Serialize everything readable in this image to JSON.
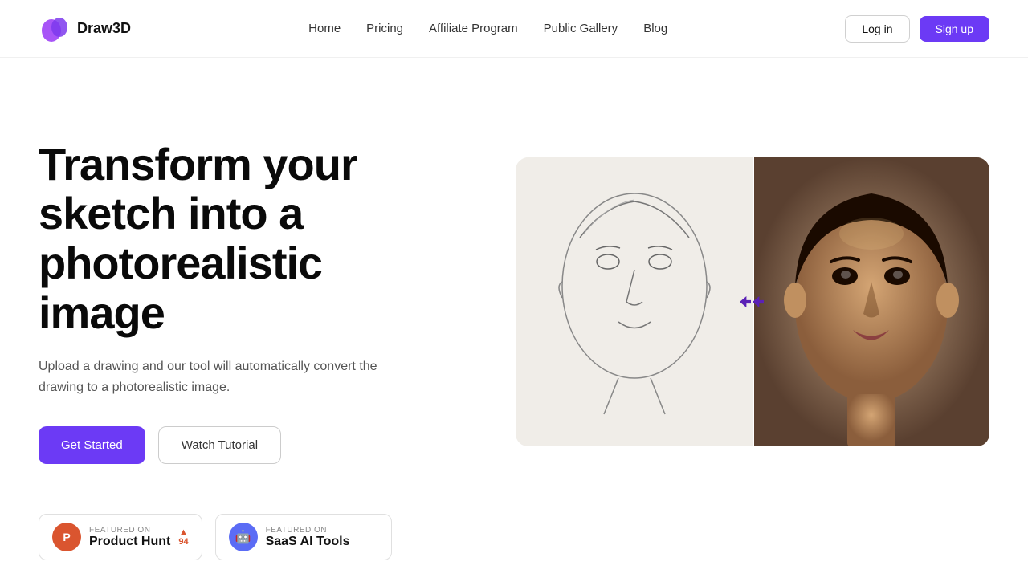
{
  "brand": {
    "name": "Draw3D",
    "logo_color": "#6c3af5"
  },
  "nav": {
    "links": [
      {
        "label": "Home",
        "id": "home"
      },
      {
        "label": "Pricing",
        "id": "pricing"
      },
      {
        "label": "Affiliate Program",
        "id": "affiliate"
      },
      {
        "label": "Public Gallery",
        "id": "gallery"
      },
      {
        "label": "Blog",
        "id": "blog"
      }
    ],
    "login_label": "Log in",
    "signup_label": "Sign up"
  },
  "hero": {
    "heading": "Transform your sketch into a photorealistic image",
    "subtext": "Upload a drawing and our tool will automatically convert the drawing to a photorealistic image.",
    "cta_primary": "Get Started",
    "cta_secondary": "Watch Tutorial"
  },
  "badges": [
    {
      "id": "product-hunt",
      "featured_label": "FEATURED ON",
      "name": "Product Hunt",
      "count": "94",
      "count_icon": "▲"
    },
    {
      "id": "saas-ai-tools",
      "featured_label": "Featured on",
      "name": "SaaS AI Tools"
    }
  ]
}
